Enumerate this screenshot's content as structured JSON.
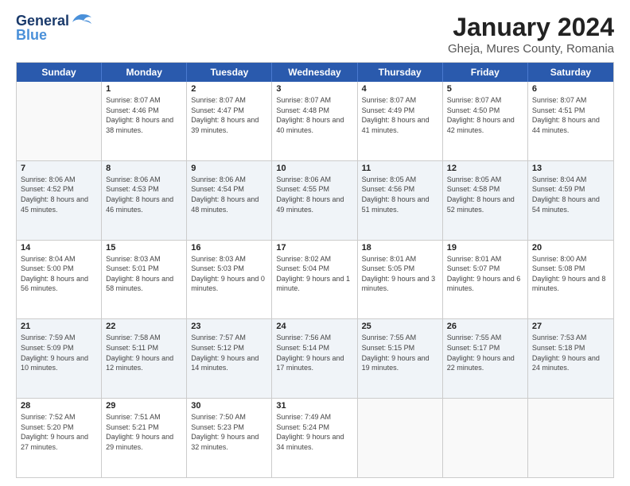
{
  "header": {
    "logo": {
      "line1": "General",
      "line2": "Blue"
    },
    "title": "January 2024",
    "subtitle": "Gheja, Mures County, Romania"
  },
  "days_of_week": [
    "Sunday",
    "Monday",
    "Tuesday",
    "Wednesday",
    "Thursday",
    "Friday",
    "Saturday"
  ],
  "weeks": [
    {
      "shade": false,
      "cells": [
        {
          "day": "",
          "empty": true
        },
        {
          "day": "1",
          "sunrise": "Sunrise: 8:07 AM",
          "sunset": "Sunset: 4:46 PM",
          "daylight": "Daylight: 8 hours and 38 minutes."
        },
        {
          "day": "2",
          "sunrise": "Sunrise: 8:07 AM",
          "sunset": "Sunset: 4:47 PM",
          "daylight": "Daylight: 8 hours and 39 minutes."
        },
        {
          "day": "3",
          "sunrise": "Sunrise: 8:07 AM",
          "sunset": "Sunset: 4:48 PM",
          "daylight": "Daylight: 8 hours and 40 minutes."
        },
        {
          "day": "4",
          "sunrise": "Sunrise: 8:07 AM",
          "sunset": "Sunset: 4:49 PM",
          "daylight": "Daylight: 8 hours and 41 minutes."
        },
        {
          "day": "5",
          "sunrise": "Sunrise: 8:07 AM",
          "sunset": "Sunset: 4:50 PM",
          "daylight": "Daylight: 8 hours and 42 minutes."
        },
        {
          "day": "6",
          "sunrise": "Sunrise: 8:07 AM",
          "sunset": "Sunset: 4:51 PM",
          "daylight": "Daylight: 8 hours and 44 minutes."
        }
      ]
    },
    {
      "shade": true,
      "cells": [
        {
          "day": "7",
          "sunrise": "Sunrise: 8:06 AM",
          "sunset": "Sunset: 4:52 PM",
          "daylight": "Daylight: 8 hours and 45 minutes."
        },
        {
          "day": "8",
          "sunrise": "Sunrise: 8:06 AM",
          "sunset": "Sunset: 4:53 PM",
          "daylight": "Daylight: 8 hours and 46 minutes."
        },
        {
          "day": "9",
          "sunrise": "Sunrise: 8:06 AM",
          "sunset": "Sunset: 4:54 PM",
          "daylight": "Daylight: 8 hours and 48 minutes."
        },
        {
          "day": "10",
          "sunrise": "Sunrise: 8:06 AM",
          "sunset": "Sunset: 4:55 PM",
          "daylight": "Daylight: 8 hours and 49 minutes."
        },
        {
          "day": "11",
          "sunrise": "Sunrise: 8:05 AM",
          "sunset": "Sunset: 4:56 PM",
          "daylight": "Daylight: 8 hours and 51 minutes."
        },
        {
          "day": "12",
          "sunrise": "Sunrise: 8:05 AM",
          "sunset": "Sunset: 4:58 PM",
          "daylight": "Daylight: 8 hours and 52 minutes."
        },
        {
          "day": "13",
          "sunrise": "Sunrise: 8:04 AM",
          "sunset": "Sunset: 4:59 PM",
          "daylight": "Daylight: 8 hours and 54 minutes."
        }
      ]
    },
    {
      "shade": false,
      "cells": [
        {
          "day": "14",
          "sunrise": "Sunrise: 8:04 AM",
          "sunset": "Sunset: 5:00 PM",
          "daylight": "Daylight: 8 hours and 56 minutes."
        },
        {
          "day": "15",
          "sunrise": "Sunrise: 8:03 AM",
          "sunset": "Sunset: 5:01 PM",
          "daylight": "Daylight: 8 hours and 58 minutes."
        },
        {
          "day": "16",
          "sunrise": "Sunrise: 8:03 AM",
          "sunset": "Sunset: 5:03 PM",
          "daylight": "Daylight: 9 hours and 0 minutes."
        },
        {
          "day": "17",
          "sunrise": "Sunrise: 8:02 AM",
          "sunset": "Sunset: 5:04 PM",
          "daylight": "Daylight: 9 hours and 1 minute."
        },
        {
          "day": "18",
          "sunrise": "Sunrise: 8:01 AM",
          "sunset": "Sunset: 5:05 PM",
          "daylight": "Daylight: 9 hours and 3 minutes."
        },
        {
          "day": "19",
          "sunrise": "Sunrise: 8:01 AM",
          "sunset": "Sunset: 5:07 PM",
          "daylight": "Daylight: 9 hours and 6 minutes."
        },
        {
          "day": "20",
          "sunrise": "Sunrise: 8:00 AM",
          "sunset": "Sunset: 5:08 PM",
          "daylight": "Daylight: 9 hours and 8 minutes."
        }
      ]
    },
    {
      "shade": true,
      "cells": [
        {
          "day": "21",
          "sunrise": "Sunrise: 7:59 AM",
          "sunset": "Sunset: 5:09 PM",
          "daylight": "Daylight: 9 hours and 10 minutes."
        },
        {
          "day": "22",
          "sunrise": "Sunrise: 7:58 AM",
          "sunset": "Sunset: 5:11 PM",
          "daylight": "Daylight: 9 hours and 12 minutes."
        },
        {
          "day": "23",
          "sunrise": "Sunrise: 7:57 AM",
          "sunset": "Sunset: 5:12 PM",
          "daylight": "Daylight: 9 hours and 14 minutes."
        },
        {
          "day": "24",
          "sunrise": "Sunrise: 7:56 AM",
          "sunset": "Sunset: 5:14 PM",
          "daylight": "Daylight: 9 hours and 17 minutes."
        },
        {
          "day": "25",
          "sunrise": "Sunrise: 7:55 AM",
          "sunset": "Sunset: 5:15 PM",
          "daylight": "Daylight: 9 hours and 19 minutes."
        },
        {
          "day": "26",
          "sunrise": "Sunrise: 7:55 AM",
          "sunset": "Sunset: 5:17 PM",
          "daylight": "Daylight: 9 hours and 22 minutes."
        },
        {
          "day": "27",
          "sunrise": "Sunrise: 7:53 AM",
          "sunset": "Sunset: 5:18 PM",
          "daylight": "Daylight: 9 hours and 24 minutes."
        }
      ]
    },
    {
      "shade": false,
      "cells": [
        {
          "day": "28",
          "sunrise": "Sunrise: 7:52 AM",
          "sunset": "Sunset: 5:20 PM",
          "daylight": "Daylight: 9 hours and 27 minutes."
        },
        {
          "day": "29",
          "sunrise": "Sunrise: 7:51 AM",
          "sunset": "Sunset: 5:21 PM",
          "daylight": "Daylight: 9 hours and 29 minutes."
        },
        {
          "day": "30",
          "sunrise": "Sunrise: 7:50 AM",
          "sunset": "Sunset: 5:23 PM",
          "daylight": "Daylight: 9 hours and 32 minutes."
        },
        {
          "day": "31",
          "sunrise": "Sunrise: 7:49 AM",
          "sunset": "Sunset: 5:24 PM",
          "daylight": "Daylight: 9 hours and 34 minutes."
        },
        {
          "day": "",
          "empty": true
        },
        {
          "day": "",
          "empty": true
        },
        {
          "day": "",
          "empty": true
        }
      ]
    }
  ]
}
